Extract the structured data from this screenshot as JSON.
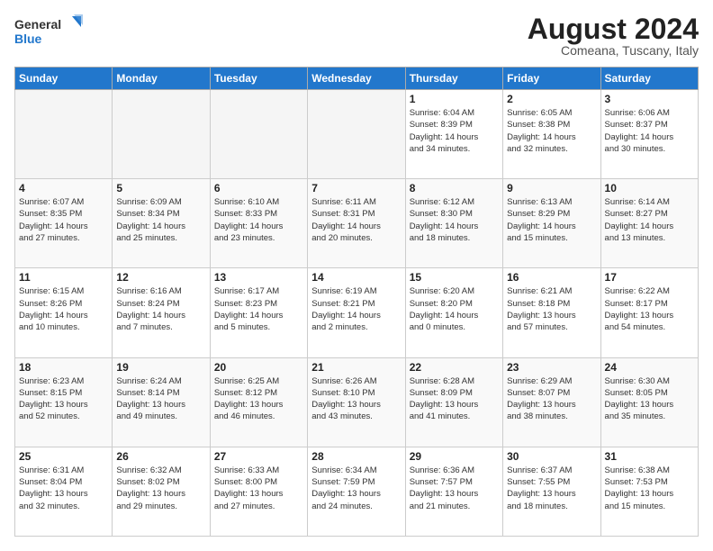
{
  "header": {
    "logo_line1": "General",
    "logo_line2": "Blue",
    "month": "August 2024",
    "location": "Comeana, Tuscany, Italy"
  },
  "days_of_week": [
    "Sunday",
    "Monday",
    "Tuesday",
    "Wednesday",
    "Thursday",
    "Friday",
    "Saturday"
  ],
  "weeks": [
    [
      {
        "num": "",
        "info": ""
      },
      {
        "num": "",
        "info": ""
      },
      {
        "num": "",
        "info": ""
      },
      {
        "num": "",
        "info": ""
      },
      {
        "num": "1",
        "info": "Sunrise: 6:04 AM\nSunset: 8:39 PM\nDaylight: 14 hours\nand 34 minutes."
      },
      {
        "num": "2",
        "info": "Sunrise: 6:05 AM\nSunset: 8:38 PM\nDaylight: 14 hours\nand 32 minutes."
      },
      {
        "num": "3",
        "info": "Sunrise: 6:06 AM\nSunset: 8:37 PM\nDaylight: 14 hours\nand 30 minutes."
      }
    ],
    [
      {
        "num": "4",
        "info": "Sunrise: 6:07 AM\nSunset: 8:35 PM\nDaylight: 14 hours\nand 27 minutes."
      },
      {
        "num": "5",
        "info": "Sunrise: 6:09 AM\nSunset: 8:34 PM\nDaylight: 14 hours\nand 25 minutes."
      },
      {
        "num": "6",
        "info": "Sunrise: 6:10 AM\nSunset: 8:33 PM\nDaylight: 14 hours\nand 23 minutes."
      },
      {
        "num": "7",
        "info": "Sunrise: 6:11 AM\nSunset: 8:31 PM\nDaylight: 14 hours\nand 20 minutes."
      },
      {
        "num": "8",
        "info": "Sunrise: 6:12 AM\nSunset: 8:30 PM\nDaylight: 14 hours\nand 18 minutes."
      },
      {
        "num": "9",
        "info": "Sunrise: 6:13 AM\nSunset: 8:29 PM\nDaylight: 14 hours\nand 15 minutes."
      },
      {
        "num": "10",
        "info": "Sunrise: 6:14 AM\nSunset: 8:27 PM\nDaylight: 14 hours\nand 13 minutes."
      }
    ],
    [
      {
        "num": "11",
        "info": "Sunrise: 6:15 AM\nSunset: 8:26 PM\nDaylight: 14 hours\nand 10 minutes."
      },
      {
        "num": "12",
        "info": "Sunrise: 6:16 AM\nSunset: 8:24 PM\nDaylight: 14 hours\nand 7 minutes."
      },
      {
        "num": "13",
        "info": "Sunrise: 6:17 AM\nSunset: 8:23 PM\nDaylight: 14 hours\nand 5 minutes."
      },
      {
        "num": "14",
        "info": "Sunrise: 6:19 AM\nSunset: 8:21 PM\nDaylight: 14 hours\nand 2 minutes."
      },
      {
        "num": "15",
        "info": "Sunrise: 6:20 AM\nSunset: 8:20 PM\nDaylight: 14 hours\nand 0 minutes."
      },
      {
        "num": "16",
        "info": "Sunrise: 6:21 AM\nSunset: 8:18 PM\nDaylight: 13 hours\nand 57 minutes."
      },
      {
        "num": "17",
        "info": "Sunrise: 6:22 AM\nSunset: 8:17 PM\nDaylight: 13 hours\nand 54 minutes."
      }
    ],
    [
      {
        "num": "18",
        "info": "Sunrise: 6:23 AM\nSunset: 8:15 PM\nDaylight: 13 hours\nand 52 minutes."
      },
      {
        "num": "19",
        "info": "Sunrise: 6:24 AM\nSunset: 8:14 PM\nDaylight: 13 hours\nand 49 minutes."
      },
      {
        "num": "20",
        "info": "Sunrise: 6:25 AM\nSunset: 8:12 PM\nDaylight: 13 hours\nand 46 minutes."
      },
      {
        "num": "21",
        "info": "Sunrise: 6:26 AM\nSunset: 8:10 PM\nDaylight: 13 hours\nand 43 minutes."
      },
      {
        "num": "22",
        "info": "Sunrise: 6:28 AM\nSunset: 8:09 PM\nDaylight: 13 hours\nand 41 minutes."
      },
      {
        "num": "23",
        "info": "Sunrise: 6:29 AM\nSunset: 8:07 PM\nDaylight: 13 hours\nand 38 minutes."
      },
      {
        "num": "24",
        "info": "Sunrise: 6:30 AM\nSunset: 8:05 PM\nDaylight: 13 hours\nand 35 minutes."
      }
    ],
    [
      {
        "num": "25",
        "info": "Sunrise: 6:31 AM\nSunset: 8:04 PM\nDaylight: 13 hours\nand 32 minutes."
      },
      {
        "num": "26",
        "info": "Sunrise: 6:32 AM\nSunset: 8:02 PM\nDaylight: 13 hours\nand 29 minutes."
      },
      {
        "num": "27",
        "info": "Sunrise: 6:33 AM\nSunset: 8:00 PM\nDaylight: 13 hours\nand 27 minutes."
      },
      {
        "num": "28",
        "info": "Sunrise: 6:34 AM\nSunset: 7:59 PM\nDaylight: 13 hours\nand 24 minutes."
      },
      {
        "num": "29",
        "info": "Sunrise: 6:36 AM\nSunset: 7:57 PM\nDaylight: 13 hours\nand 21 minutes."
      },
      {
        "num": "30",
        "info": "Sunrise: 6:37 AM\nSunset: 7:55 PM\nDaylight: 13 hours\nand 18 minutes."
      },
      {
        "num": "31",
        "info": "Sunrise: 6:38 AM\nSunset: 7:53 PM\nDaylight: 13 hours\nand 15 minutes."
      }
    ]
  ]
}
